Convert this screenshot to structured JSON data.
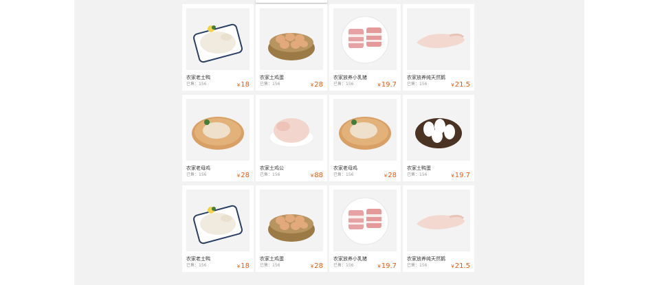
{
  "currency_symbol": "¥",
  "products": [
    {
      "name": "农家老土鸭",
      "sold": "已售：156",
      "price": "18",
      "icon": "roast-duck-tray-icon"
    },
    {
      "name": "农家土鸡蛋",
      "sold": "已售：156",
      "price": "28",
      "icon": "egg-basket-icon"
    },
    {
      "name": "农家放养小乳猪",
      "sold": "已售：156",
      "price": "19.7",
      "icon": "pork-plate-icon"
    },
    {
      "name": "农家放养纯天然鹅",
      "sold": "已售：156",
      "price": "21.5",
      "icon": "raw-goose-icon"
    },
    {
      "name": "农家老母鸡",
      "sold": "已售：156",
      "price": "28",
      "icon": "chicken-board-icon"
    },
    {
      "name": "农家土鸡公",
      "sold": "已售：156",
      "price": "88",
      "icon": "raw-chicken-plate-icon"
    },
    {
      "name": "农家老母鸡",
      "sold": "已售：156",
      "price": "28",
      "icon": "chicken-board-icon"
    },
    {
      "name": "农家土鸭蛋",
      "sold": "已售：156",
      "price": "19.7",
      "icon": "duck-egg-basket-icon"
    },
    {
      "name": "农家老土鸭",
      "sold": "已售：156",
      "price": "18",
      "icon": "roast-duck-tray-icon"
    },
    {
      "name": "农家土鸡蛋",
      "sold": "已售：156",
      "price": "28",
      "icon": "egg-basket-icon"
    },
    {
      "name": "农家放养小乳猪",
      "sold": "已售：156",
      "price": "19.7",
      "icon": "pork-plate-icon"
    },
    {
      "name": "农家放养纯天然鹅",
      "sold": "已售：156",
      "price": "21.5",
      "icon": "raw-goose-icon"
    }
  ]
}
